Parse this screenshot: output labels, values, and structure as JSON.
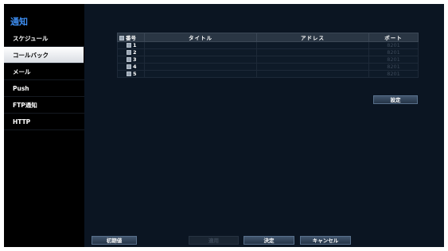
{
  "sidebar": {
    "title": "通知",
    "items": [
      {
        "label": "スケジュール",
        "active": false
      },
      {
        "label": "コールバック",
        "active": true
      },
      {
        "label": "メール",
        "active": false
      },
      {
        "label": "Push",
        "active": false
      },
      {
        "label": "FTP通知",
        "active": false
      },
      {
        "label": "HTTP",
        "active": false
      }
    ]
  },
  "table": {
    "headers": {
      "number": "番号",
      "title": "タイトル",
      "address": "アドレス",
      "port": "ポート"
    },
    "rows": [
      {
        "number": "1",
        "title": "",
        "address": "",
        "port": "8201"
      },
      {
        "number": "2",
        "title": "",
        "address": "",
        "port": "8201"
      },
      {
        "number": "3",
        "title": "",
        "address": "",
        "port": "8201"
      },
      {
        "number": "4",
        "title": "",
        "address": "",
        "port": "8201"
      },
      {
        "number": "5",
        "title": "",
        "address": "",
        "port": "8201"
      }
    ]
  },
  "buttons": {
    "setting": "設定",
    "default": "初期値",
    "apply": "適用",
    "ok": "決定",
    "cancel": "キャンセル"
  },
  "colors": {
    "accent": "#3d8df0",
    "background": "#0b1522",
    "sidebar": "#000000"
  }
}
